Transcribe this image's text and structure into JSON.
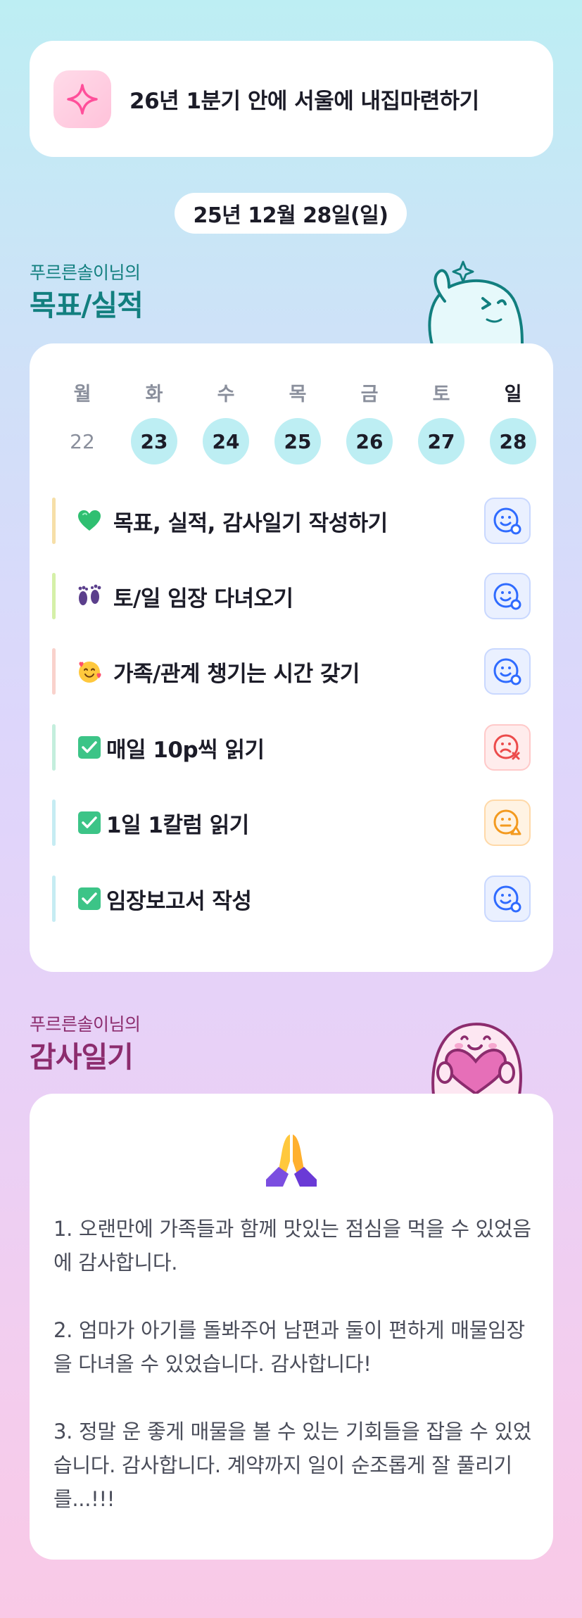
{
  "goal": {
    "text": "26년 1분기 안에 서울에 내집마련하기",
    "icon": "sparkle-icon"
  },
  "date": "25년 12월 28일(일)",
  "goals_section": {
    "owner": "푸르른솔이님의",
    "title": "목표/실적"
  },
  "week": {
    "days": [
      {
        "label": "월",
        "num": "22",
        "active": false
      },
      {
        "label": "화",
        "num": "23",
        "active": true
      },
      {
        "label": "수",
        "num": "24",
        "active": true
      },
      {
        "label": "목",
        "num": "25",
        "active": true
      },
      {
        "label": "금",
        "num": "26",
        "active": true
      },
      {
        "label": "토",
        "num": "27",
        "active": true
      },
      {
        "label": "일",
        "num": "28",
        "active": true,
        "today": true
      }
    ]
  },
  "tasks": [
    {
      "emoji": "green-heart-icon",
      "label": "목표, 실적, 감사일기 작성하기",
      "bar_color": "#f6dfa8",
      "status": "good"
    },
    {
      "emoji": "footprints-icon",
      "label": "토/일 임장 다녀오기",
      "bar_color": "#d5f0a8",
      "status": "good"
    },
    {
      "emoji": "smiling-face-with-hearts-icon",
      "label": "가족/관계 챙기는 시간 갖기",
      "bar_color": "#f9d2cc",
      "status": "good"
    },
    {
      "emoji": "check-box-icon",
      "label": "매일 10p씩 읽기",
      "bar_color": "#c4eedd",
      "status": "bad"
    },
    {
      "emoji": "check-box-icon",
      "label": "1일 1칼럼 읽기",
      "bar_color": "#c6ecf3",
      "status": "mid"
    },
    {
      "emoji": "check-box-icon",
      "label": "임장보고서 작성",
      "bar_color": "#c6ecf3",
      "status": "good"
    }
  ],
  "gratitude_section": {
    "owner": "푸르른솔이님의",
    "title": "감사일기"
  },
  "diary": {
    "icon": "folded-hands-icon",
    "entries": [
      "1. 오랜만에 가족들과 함께 맛있는 점심을 먹을 수 있었음에 감사합니다.",
      "2. 엄마가 아기를 돌봐주어 남편과 둘이 편하게 매물임장을 다녀올 수 있었습니다. 감사합니다!",
      "3. 정말 운 좋게 매물을 볼 수 있는 기회들을 잡을 수 있었습니다. 감사합니다. 계약까지 일이 순조롭게 잘 풀리기를...!!!"
    ]
  },
  "colors": {
    "accent_teal": "#127f7f",
    "accent_plum": "#8c2c6e",
    "day_active": "#bdeef3"
  }
}
